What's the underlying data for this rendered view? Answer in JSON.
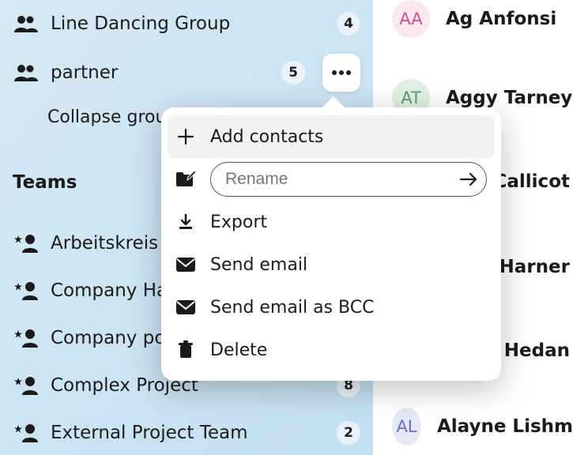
{
  "sidebar": {
    "groups": [
      {
        "label": "Line Dancing Group",
        "count": 4
      },
      {
        "label": "partner",
        "count": 5
      }
    ],
    "collapse_label": "Collapse groups",
    "section_teams_label": "Teams",
    "teams": [
      {
        "label": "Arbeitskreis"
      },
      {
        "label": "Company Handbook"
      },
      {
        "label": "Company policies"
      },
      {
        "label": "Complex Project",
        "count": 8
      },
      {
        "label": "External Project Team",
        "count": 2
      }
    ]
  },
  "popover": {
    "add_contacts_label": "Add contacts",
    "rename_placeholder": "Rename",
    "export_label": "Export",
    "send_email_label": "Send email",
    "send_email_bcc_label": "Send email as BCC",
    "delete_label": "Delete"
  },
  "contacts": [
    {
      "initials": "AA",
      "name": "Ag Anfonsi",
      "bg": "#fae7f0",
      "fg": "#c94f8b"
    },
    {
      "initials": "AT",
      "name": "Aggy Tarney",
      "bg": "#def0e3",
      "fg": "#5f9a6d"
    },
    {
      "initials": "",
      "name": "el Callicot"
    },
    {
      "initials": "",
      "name": "a Harner"
    },
    {
      "initials": "",
      "name": "d Hedan"
    },
    {
      "initials": "AL",
      "name": "Alayne Lishm",
      "bg": "#e6e8f8",
      "fg": "#6a6fc2"
    }
  ]
}
